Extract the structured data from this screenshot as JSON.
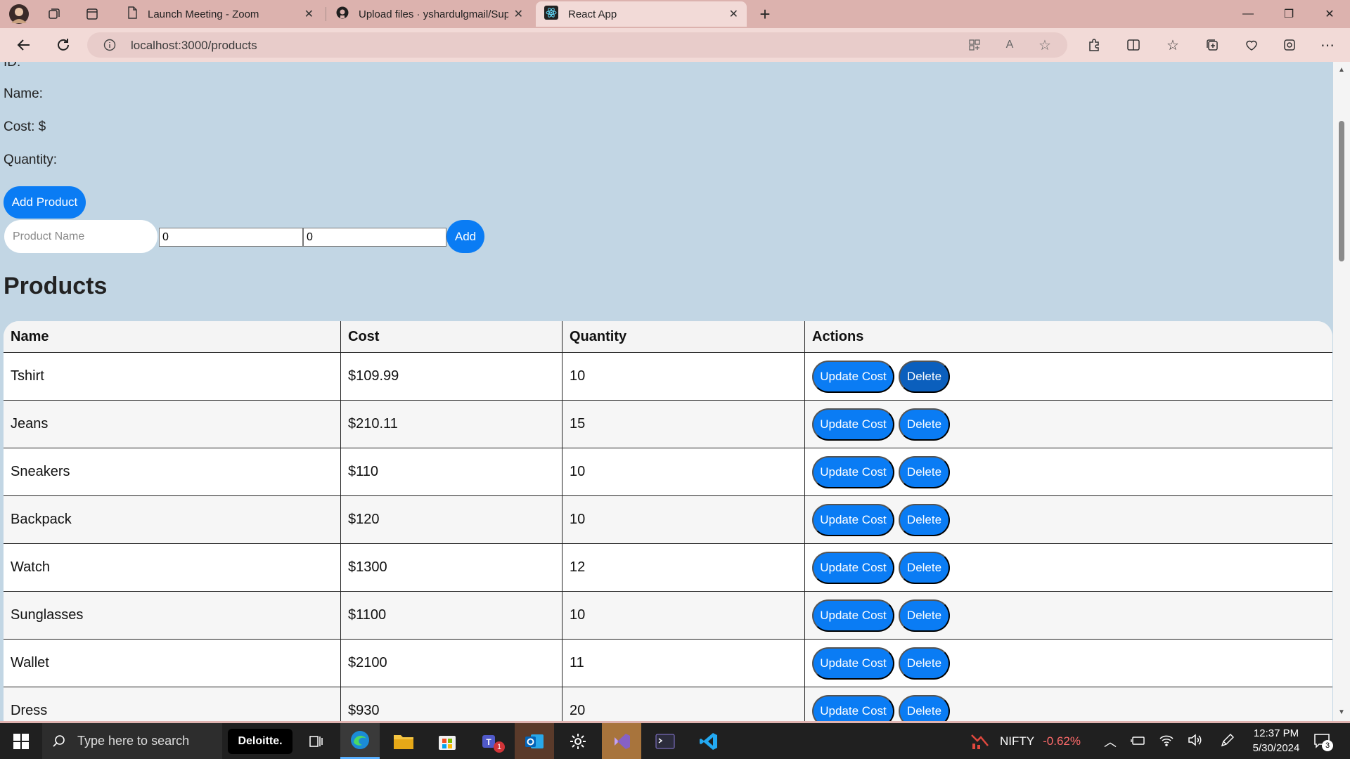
{
  "browser": {
    "tabs": [
      {
        "label": "Launch Meeting - Zoom",
        "icon": "document-icon"
      },
      {
        "label": "Upload files · yshardulgmail/Sup",
        "icon": "github-icon"
      },
      {
        "label": "React App",
        "icon": "react-icon"
      }
    ],
    "url": "localhost:3000/products"
  },
  "details": {
    "id_label": "ID:",
    "name_label": "Name:",
    "cost_label": "Cost: $",
    "quantity_label": "Quantity:"
  },
  "form": {
    "add_product_label": "Add Product",
    "name_placeholder": "Product Name",
    "cost_value": "0",
    "quantity_value": "0",
    "add_label": "Add"
  },
  "products": {
    "title": "Products",
    "columns": [
      "Name",
      "Cost",
      "Quantity",
      "Actions"
    ],
    "update_label": "Update Cost",
    "delete_label": "Delete",
    "rows": [
      {
        "name": "Tshirt",
        "cost": "$109.99",
        "quantity": "10"
      },
      {
        "name": "Jeans",
        "cost": "$210.11",
        "quantity": "15"
      },
      {
        "name": "Sneakers",
        "cost": "$110",
        "quantity": "10"
      },
      {
        "name": "Backpack",
        "cost": "$120",
        "quantity": "10"
      },
      {
        "name": "Watch",
        "cost": "$1300",
        "quantity": "12"
      },
      {
        "name": "Sunglasses",
        "cost": "$1100",
        "quantity": "10"
      },
      {
        "name": "Wallet",
        "cost": "$2100",
        "quantity": "11"
      },
      {
        "name": "Dress",
        "cost": "$930",
        "quantity": "20"
      }
    ]
  },
  "taskbar": {
    "search_placeholder": "Type here to search",
    "deloitte_label": "Deloitte.",
    "stock_name": "NIFTY",
    "stock_change": "-0.62%",
    "time": "12:37 PM",
    "date": "5/30/2024",
    "notification_count": "3",
    "teams_badge": "1"
  },
  "colors": {
    "accent": "#0a7cf4",
    "page_bg": "#c2d6e4",
    "stock_down": "#ff6b6b"
  }
}
